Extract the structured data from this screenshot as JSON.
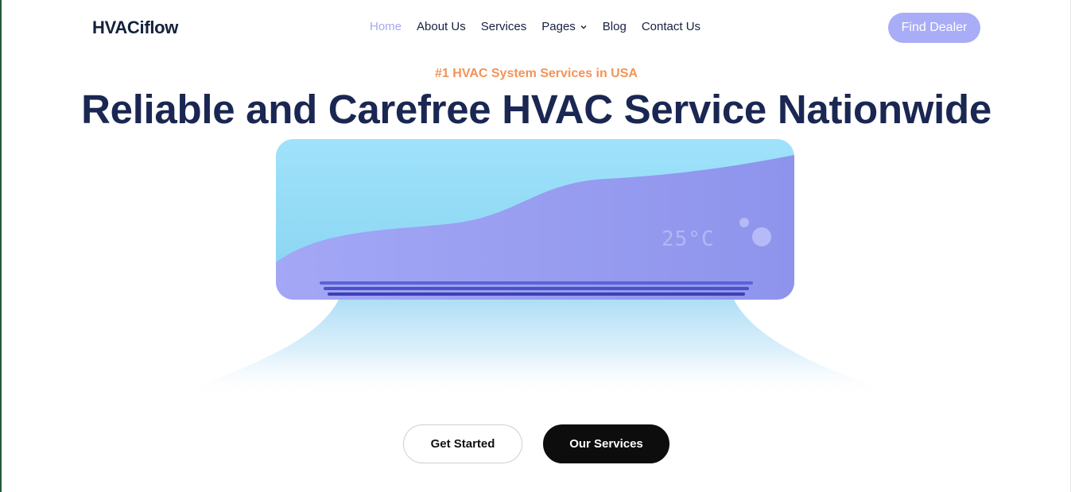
{
  "brand": {
    "logo_text": "HVACiflow"
  },
  "nav": {
    "items": [
      {
        "label": "Home",
        "active": true
      },
      {
        "label": "About Us"
      },
      {
        "label": "Services"
      },
      {
        "label": "Pages",
        "has_dropdown": true,
        "icon": "chevron-down-icon"
      },
      {
        "label": "Blog"
      },
      {
        "label": "Contact Us"
      }
    ],
    "cta_label": "Find Dealer"
  },
  "hero": {
    "tagline": "#1 HVAC System Services in USA",
    "title": "Reliable and Carefree HVAC Service Nationwide",
    "ac_display_temp": "25°C",
    "primary_button": "Get Started",
    "secondary_button": "Our Services"
  },
  "colors": {
    "brand_dark": "#1a2752",
    "accent_orange": "#f29458",
    "accent_lavender": "#a9acf6",
    "ac_top": "#9fdff8",
    "ac_body": "#9ea3f2",
    "button_dark": "#0d0d0d"
  }
}
